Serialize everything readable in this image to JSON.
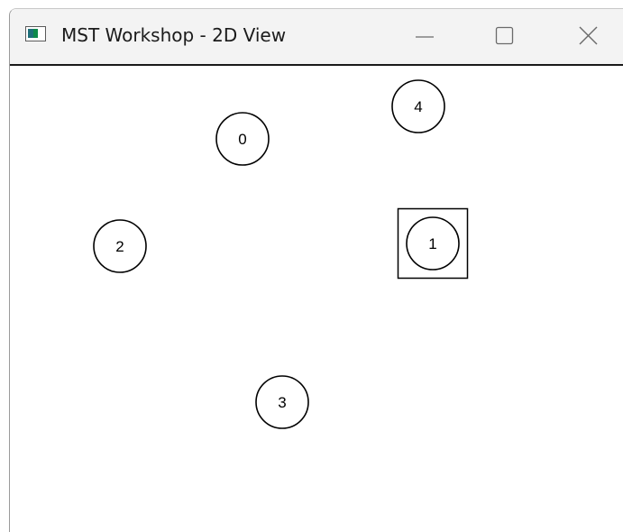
{
  "window": {
    "title": "MST Workshop - 2D View",
    "icon": "app-window-icon",
    "controls": [
      {
        "name": "minimize-button",
        "icon": "minimize-icon"
      },
      {
        "name": "maximize-button",
        "icon": "maximize-icon"
      },
      {
        "name": "close-button",
        "icon": "close-icon"
      }
    ]
  },
  "graph": {
    "nodes": [
      {
        "id": "0",
        "label": "0"
      },
      {
        "id": "1",
        "label": "1",
        "selected": true
      },
      {
        "id": "2",
        "label": "2"
      },
      {
        "id": "3",
        "label": "3"
      },
      {
        "id": "4",
        "label": "4"
      }
    ],
    "edges": []
  },
  "colors": {
    "titlebar": "#f3f3f3",
    "canvas": "#ffffff",
    "stroke": "#000000"
  }
}
